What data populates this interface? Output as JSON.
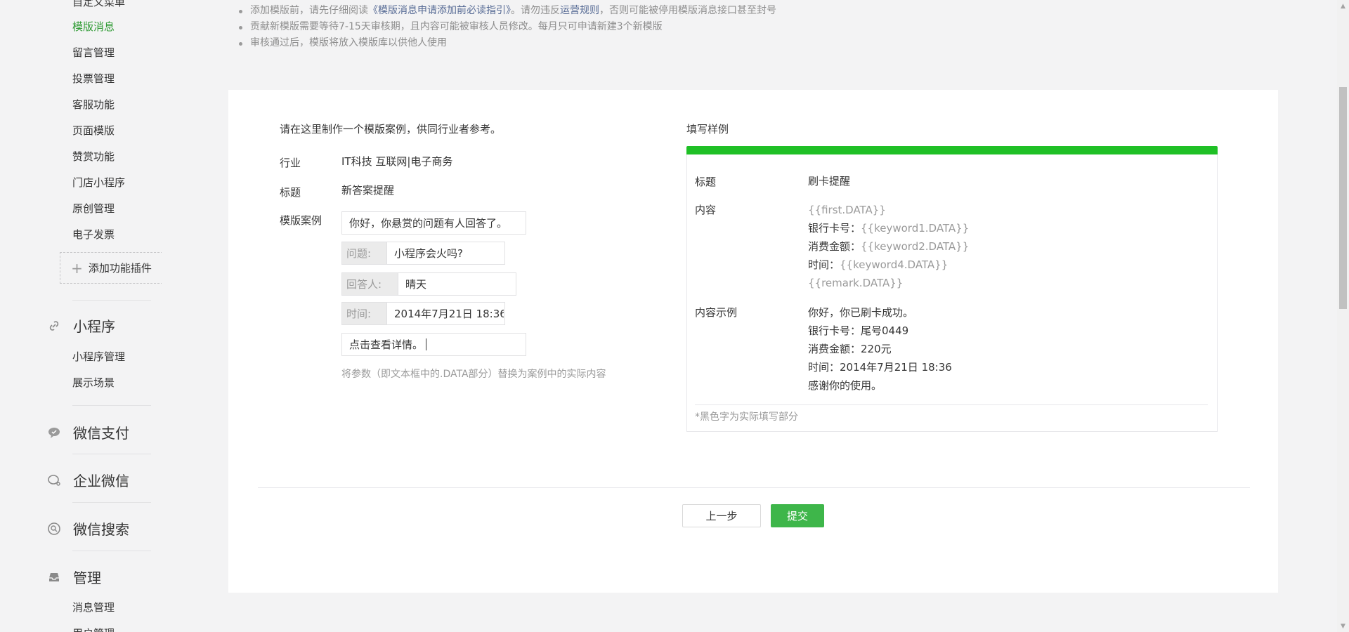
{
  "sidebar": {
    "partial_top": "自定义菜单",
    "items_top": [
      "模版消息",
      "留言管理",
      "投票管理",
      "客服功能",
      "页面模版",
      "赞赏功能",
      "门店小程序",
      "原创管理",
      "电子发票"
    ],
    "add_plugin": "添加功能插件",
    "sec_miniprogram": "小程序",
    "mini_items": [
      "小程序管理",
      "展示场景"
    ],
    "sec_pay": "微信支付",
    "sec_work": "企业微信",
    "sec_search": "微信搜索",
    "sec_manage": "管理",
    "manage_items": [
      "消息管理",
      "用户管理"
    ]
  },
  "notes": {
    "n1_pre": "添加模版前，请先仔细阅读",
    "n1_link1": "《模版消息申请添加前必读指引》",
    "n1_mid": "。请勿违反",
    "n1_link2": "运营规则",
    "n1_post": "，否则可能被停用模版消息接口甚至封号",
    "n2": "贡献新模版需要等待7-15天审核期，且内容可能被审核人员修改。每月只可申请新建3个新模版",
    "n3": "审核通过后，模版将放入模版库以供他人使用"
  },
  "form": {
    "intro": "请在这里制作一个模版案例，供同行业者参考。",
    "industry_label": "行业",
    "industry_value": "IT科技 互联网|电子商务",
    "title_label": "标题",
    "title_value": "新答案提醒",
    "case_label": "模版案例",
    "input1": "你好，你悬赏的问题有人回答了。",
    "q_prefix": "问题:",
    "q_value": "小程序会火吗?",
    "a_prefix": "回答人:",
    "a_value": "晴天",
    "t_prefix": "时间:",
    "t_value": "2014年7月21日 18:36",
    "input5": "点击查看详情。",
    "hint": "将参数（即文本框中的.DATA部分）替换为案例中的实际内容"
  },
  "sample": {
    "title": "填写样例",
    "title_label": "标题",
    "title_value": "刷卡提醒",
    "content_label": "内容",
    "content_first": "{{first.DATA}}",
    "content_l2_label": "银行卡号：",
    "content_l2_value": "{{keyword1.DATA}}",
    "content_l3_label": "消费金额：",
    "content_l3_value": "{{keyword2.DATA}}",
    "content_l4_label": "时间：",
    "content_l4_value": "{{keyword4.DATA}}",
    "content_remark": "{{remark.DATA}}",
    "example_label": "内容示例",
    "ex1": "你好，你已刷卡成功。",
    "ex2": "银行卡号：尾号0449",
    "ex3": "消费金额：220元",
    "ex4": "时间：2014年7月21日 18:36",
    "ex5": "感谢你的使用。",
    "note": "*黑色字为实际填写部分"
  },
  "actions": {
    "prev": "上一步",
    "submit": "提交"
  },
  "colors": {
    "accent_green": "#1fc026",
    "active_menu": "#2f9b34",
    "submit_bg": "#3eb64a",
    "link": "#576b95"
  }
}
